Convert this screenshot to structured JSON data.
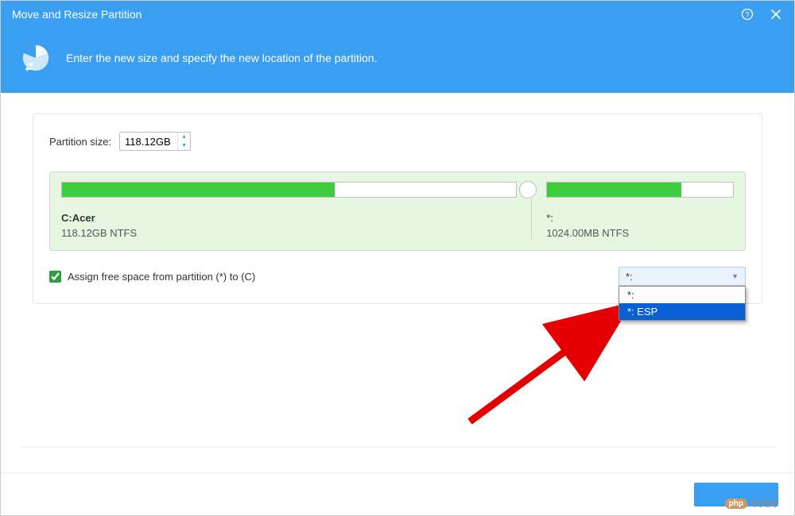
{
  "window": {
    "title": "Move and Resize Partition"
  },
  "header": {
    "subtitle": "Enter the new size and specify the new location of the partition."
  },
  "form": {
    "size_label": "Partition size:",
    "size_value": "118.12GB",
    "assign_label": "Assign free space from partition (*) to (C)"
  },
  "partitions": {
    "left": {
      "name": "C:Acer",
      "detail": "118.12GB NTFS",
      "fill_pct": 60
    },
    "right": {
      "name": "*:",
      "detail": "1024.00MB NTFS",
      "fill_pct": 72
    }
  },
  "combo": {
    "selected": "*:",
    "options": [
      {
        "label": "*:",
        "selected": false
      },
      {
        "label": "*: ESP",
        "selected": true
      }
    ]
  },
  "footer": {
    "primary": " "
  },
  "watermark": {
    "brand": "php",
    "text": "中文网"
  }
}
